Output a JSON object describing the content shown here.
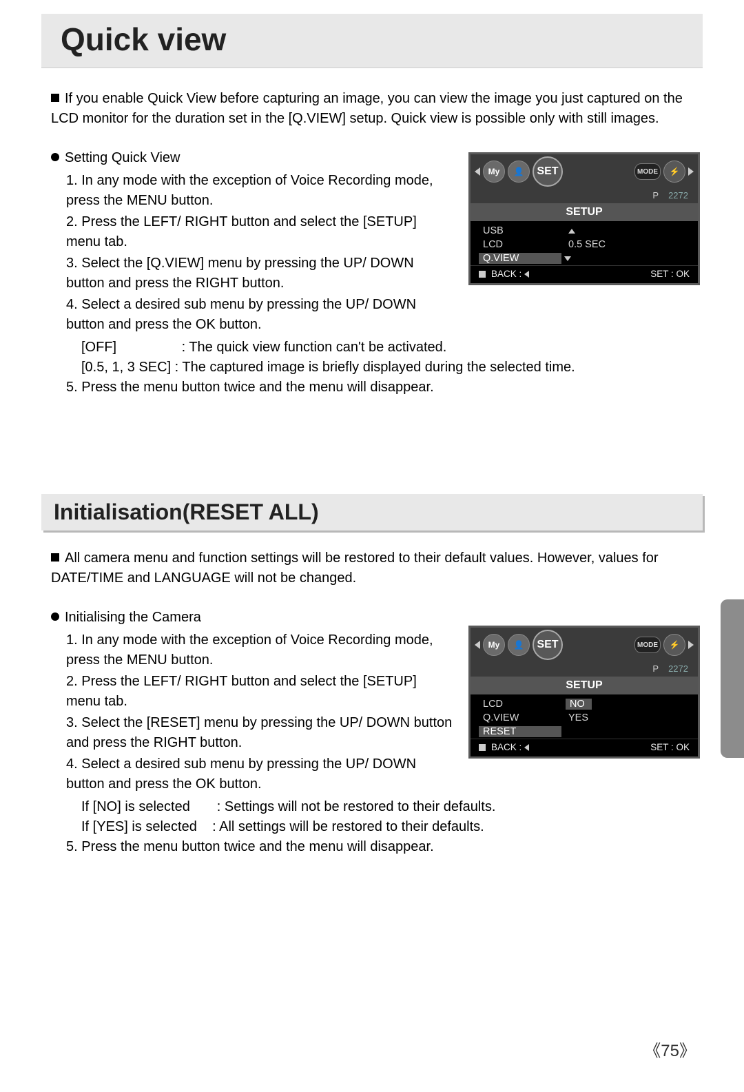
{
  "title": "Quick view",
  "intro": "If you enable Quick View before capturing an image, you can view the image you just captured on the LCD monitor for the duration set in the [Q.VIEW] setup. Quick view is possible only with still images.",
  "qv_heading": "Setting Quick View",
  "qv_steps": {
    "s1": "In any mode with the exception of Voice Recording mode, press the MENU button.",
    "s2": "Press the LEFT/ RIGHT button and select the [SETUP] menu tab.",
    "s3": "Select the [Q.VIEW] menu by pressing the UP/ DOWN button and press the RIGHT button.",
    "s4": "Select a desired sub menu by pressing the UP/ DOWN button and press the OK button.",
    "opt1_label": "[OFF]",
    "opt1_desc": ": The quick view function can't be activated.",
    "opt2_label": "[0.5, 1, 3 SEC]",
    "opt2_desc": ": The captured image is briefly displayed during the selected time.",
    "s5": "Press the menu button twice and the menu will disappear."
  },
  "lcd1": {
    "set_label": "SET",
    "mode_label": "MODE",
    "p_label": "P",
    "res_label": "2272",
    "setup": "SETUP",
    "rows": [
      {
        "label": "USB",
        "val": ""
      },
      {
        "label": "LCD",
        "val": "0.5 SEC"
      },
      {
        "label": "Q.VIEW",
        "val": ""
      }
    ],
    "back": "BACK :",
    "setok": "SET : OK"
  },
  "section2_title": "Initialisation(RESET ALL)",
  "reset_intro": "All camera menu and function settings will be restored to their default values. However, values for DATE/TIME and LANGUAGE will not be changed.",
  "reset_heading": "Initialising the Camera",
  "reset_steps": {
    "s1": "In any mode with the exception of Voice Recording mode, press the MENU button.",
    "s2": "Press the LEFT/ RIGHT button and select the [SETUP] menu tab.",
    "s3": "Select the [RESET] menu by pressing the UP/ DOWN button and press the RIGHT button.",
    "s4": "Select a desired sub menu by pressing the UP/ DOWN button and press the OK button.",
    "opt1_label": "If [NO] is selected",
    "opt1_desc": ": Settings will not be restored to their defaults.",
    "opt2_label": "If [YES] is selected",
    "opt2_desc": ": All settings will be restored to their defaults.",
    "s5": "Press the menu button twice and the menu will disappear."
  },
  "lcd2": {
    "set_label": "SET",
    "mode_label": "MODE",
    "p_label": "P",
    "res_label": "2272",
    "setup": "SETUP",
    "rows": [
      {
        "label": "LCD",
        "val": "NO"
      },
      {
        "label": "Q.VIEW",
        "val": "YES"
      },
      {
        "label": "RESET",
        "val": ""
      }
    ],
    "back": "BACK :",
    "setok": "SET : OK"
  },
  "page_number": "75"
}
